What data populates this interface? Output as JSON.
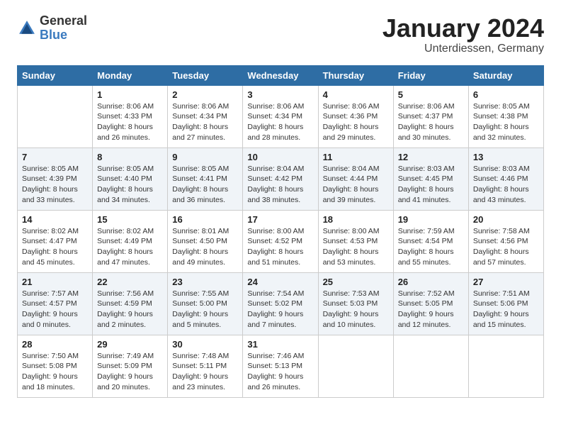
{
  "header": {
    "logo_general": "General",
    "logo_blue": "Blue",
    "month_title": "January 2024",
    "subtitle": "Unterdiessen, Germany"
  },
  "days_of_week": [
    "Sunday",
    "Monday",
    "Tuesday",
    "Wednesday",
    "Thursday",
    "Friday",
    "Saturday"
  ],
  "weeks": [
    [
      {
        "day": "",
        "content": ""
      },
      {
        "day": "1",
        "content": "Sunrise: 8:06 AM\nSunset: 4:33 PM\nDaylight: 8 hours\nand 26 minutes."
      },
      {
        "day": "2",
        "content": "Sunrise: 8:06 AM\nSunset: 4:34 PM\nDaylight: 8 hours\nand 27 minutes."
      },
      {
        "day": "3",
        "content": "Sunrise: 8:06 AM\nSunset: 4:34 PM\nDaylight: 8 hours\nand 28 minutes."
      },
      {
        "day": "4",
        "content": "Sunrise: 8:06 AM\nSunset: 4:36 PM\nDaylight: 8 hours\nand 29 minutes."
      },
      {
        "day": "5",
        "content": "Sunrise: 8:06 AM\nSunset: 4:37 PM\nDaylight: 8 hours\nand 30 minutes."
      },
      {
        "day": "6",
        "content": "Sunrise: 8:05 AM\nSunset: 4:38 PM\nDaylight: 8 hours\nand 32 minutes."
      }
    ],
    [
      {
        "day": "7",
        "content": "Sunrise: 8:05 AM\nSunset: 4:39 PM\nDaylight: 8 hours\nand 33 minutes."
      },
      {
        "day": "8",
        "content": "Sunrise: 8:05 AM\nSunset: 4:40 PM\nDaylight: 8 hours\nand 34 minutes."
      },
      {
        "day": "9",
        "content": "Sunrise: 8:05 AM\nSunset: 4:41 PM\nDaylight: 8 hours\nand 36 minutes."
      },
      {
        "day": "10",
        "content": "Sunrise: 8:04 AM\nSunset: 4:42 PM\nDaylight: 8 hours\nand 38 minutes."
      },
      {
        "day": "11",
        "content": "Sunrise: 8:04 AM\nSunset: 4:44 PM\nDaylight: 8 hours\nand 39 minutes."
      },
      {
        "day": "12",
        "content": "Sunrise: 8:03 AM\nSunset: 4:45 PM\nDaylight: 8 hours\nand 41 minutes."
      },
      {
        "day": "13",
        "content": "Sunrise: 8:03 AM\nSunset: 4:46 PM\nDaylight: 8 hours\nand 43 minutes."
      }
    ],
    [
      {
        "day": "14",
        "content": "Sunrise: 8:02 AM\nSunset: 4:47 PM\nDaylight: 8 hours\nand 45 minutes."
      },
      {
        "day": "15",
        "content": "Sunrise: 8:02 AM\nSunset: 4:49 PM\nDaylight: 8 hours\nand 47 minutes."
      },
      {
        "day": "16",
        "content": "Sunrise: 8:01 AM\nSunset: 4:50 PM\nDaylight: 8 hours\nand 49 minutes."
      },
      {
        "day": "17",
        "content": "Sunrise: 8:00 AM\nSunset: 4:52 PM\nDaylight: 8 hours\nand 51 minutes."
      },
      {
        "day": "18",
        "content": "Sunrise: 8:00 AM\nSunset: 4:53 PM\nDaylight: 8 hours\nand 53 minutes."
      },
      {
        "day": "19",
        "content": "Sunrise: 7:59 AM\nSunset: 4:54 PM\nDaylight: 8 hours\nand 55 minutes."
      },
      {
        "day": "20",
        "content": "Sunrise: 7:58 AM\nSunset: 4:56 PM\nDaylight: 8 hours\nand 57 minutes."
      }
    ],
    [
      {
        "day": "21",
        "content": "Sunrise: 7:57 AM\nSunset: 4:57 PM\nDaylight: 9 hours\nand 0 minutes."
      },
      {
        "day": "22",
        "content": "Sunrise: 7:56 AM\nSunset: 4:59 PM\nDaylight: 9 hours\nand 2 minutes."
      },
      {
        "day": "23",
        "content": "Sunrise: 7:55 AM\nSunset: 5:00 PM\nDaylight: 9 hours\nand 5 minutes."
      },
      {
        "day": "24",
        "content": "Sunrise: 7:54 AM\nSunset: 5:02 PM\nDaylight: 9 hours\nand 7 minutes."
      },
      {
        "day": "25",
        "content": "Sunrise: 7:53 AM\nSunset: 5:03 PM\nDaylight: 9 hours\nand 10 minutes."
      },
      {
        "day": "26",
        "content": "Sunrise: 7:52 AM\nSunset: 5:05 PM\nDaylight: 9 hours\nand 12 minutes."
      },
      {
        "day": "27",
        "content": "Sunrise: 7:51 AM\nSunset: 5:06 PM\nDaylight: 9 hours\nand 15 minutes."
      }
    ],
    [
      {
        "day": "28",
        "content": "Sunrise: 7:50 AM\nSunset: 5:08 PM\nDaylight: 9 hours\nand 18 minutes."
      },
      {
        "day": "29",
        "content": "Sunrise: 7:49 AM\nSunset: 5:09 PM\nDaylight: 9 hours\nand 20 minutes."
      },
      {
        "day": "30",
        "content": "Sunrise: 7:48 AM\nSunset: 5:11 PM\nDaylight: 9 hours\nand 23 minutes."
      },
      {
        "day": "31",
        "content": "Sunrise: 7:46 AM\nSunset: 5:13 PM\nDaylight: 9 hours\nand 26 minutes."
      },
      {
        "day": "",
        "content": ""
      },
      {
        "day": "",
        "content": ""
      },
      {
        "day": "",
        "content": ""
      }
    ]
  ]
}
